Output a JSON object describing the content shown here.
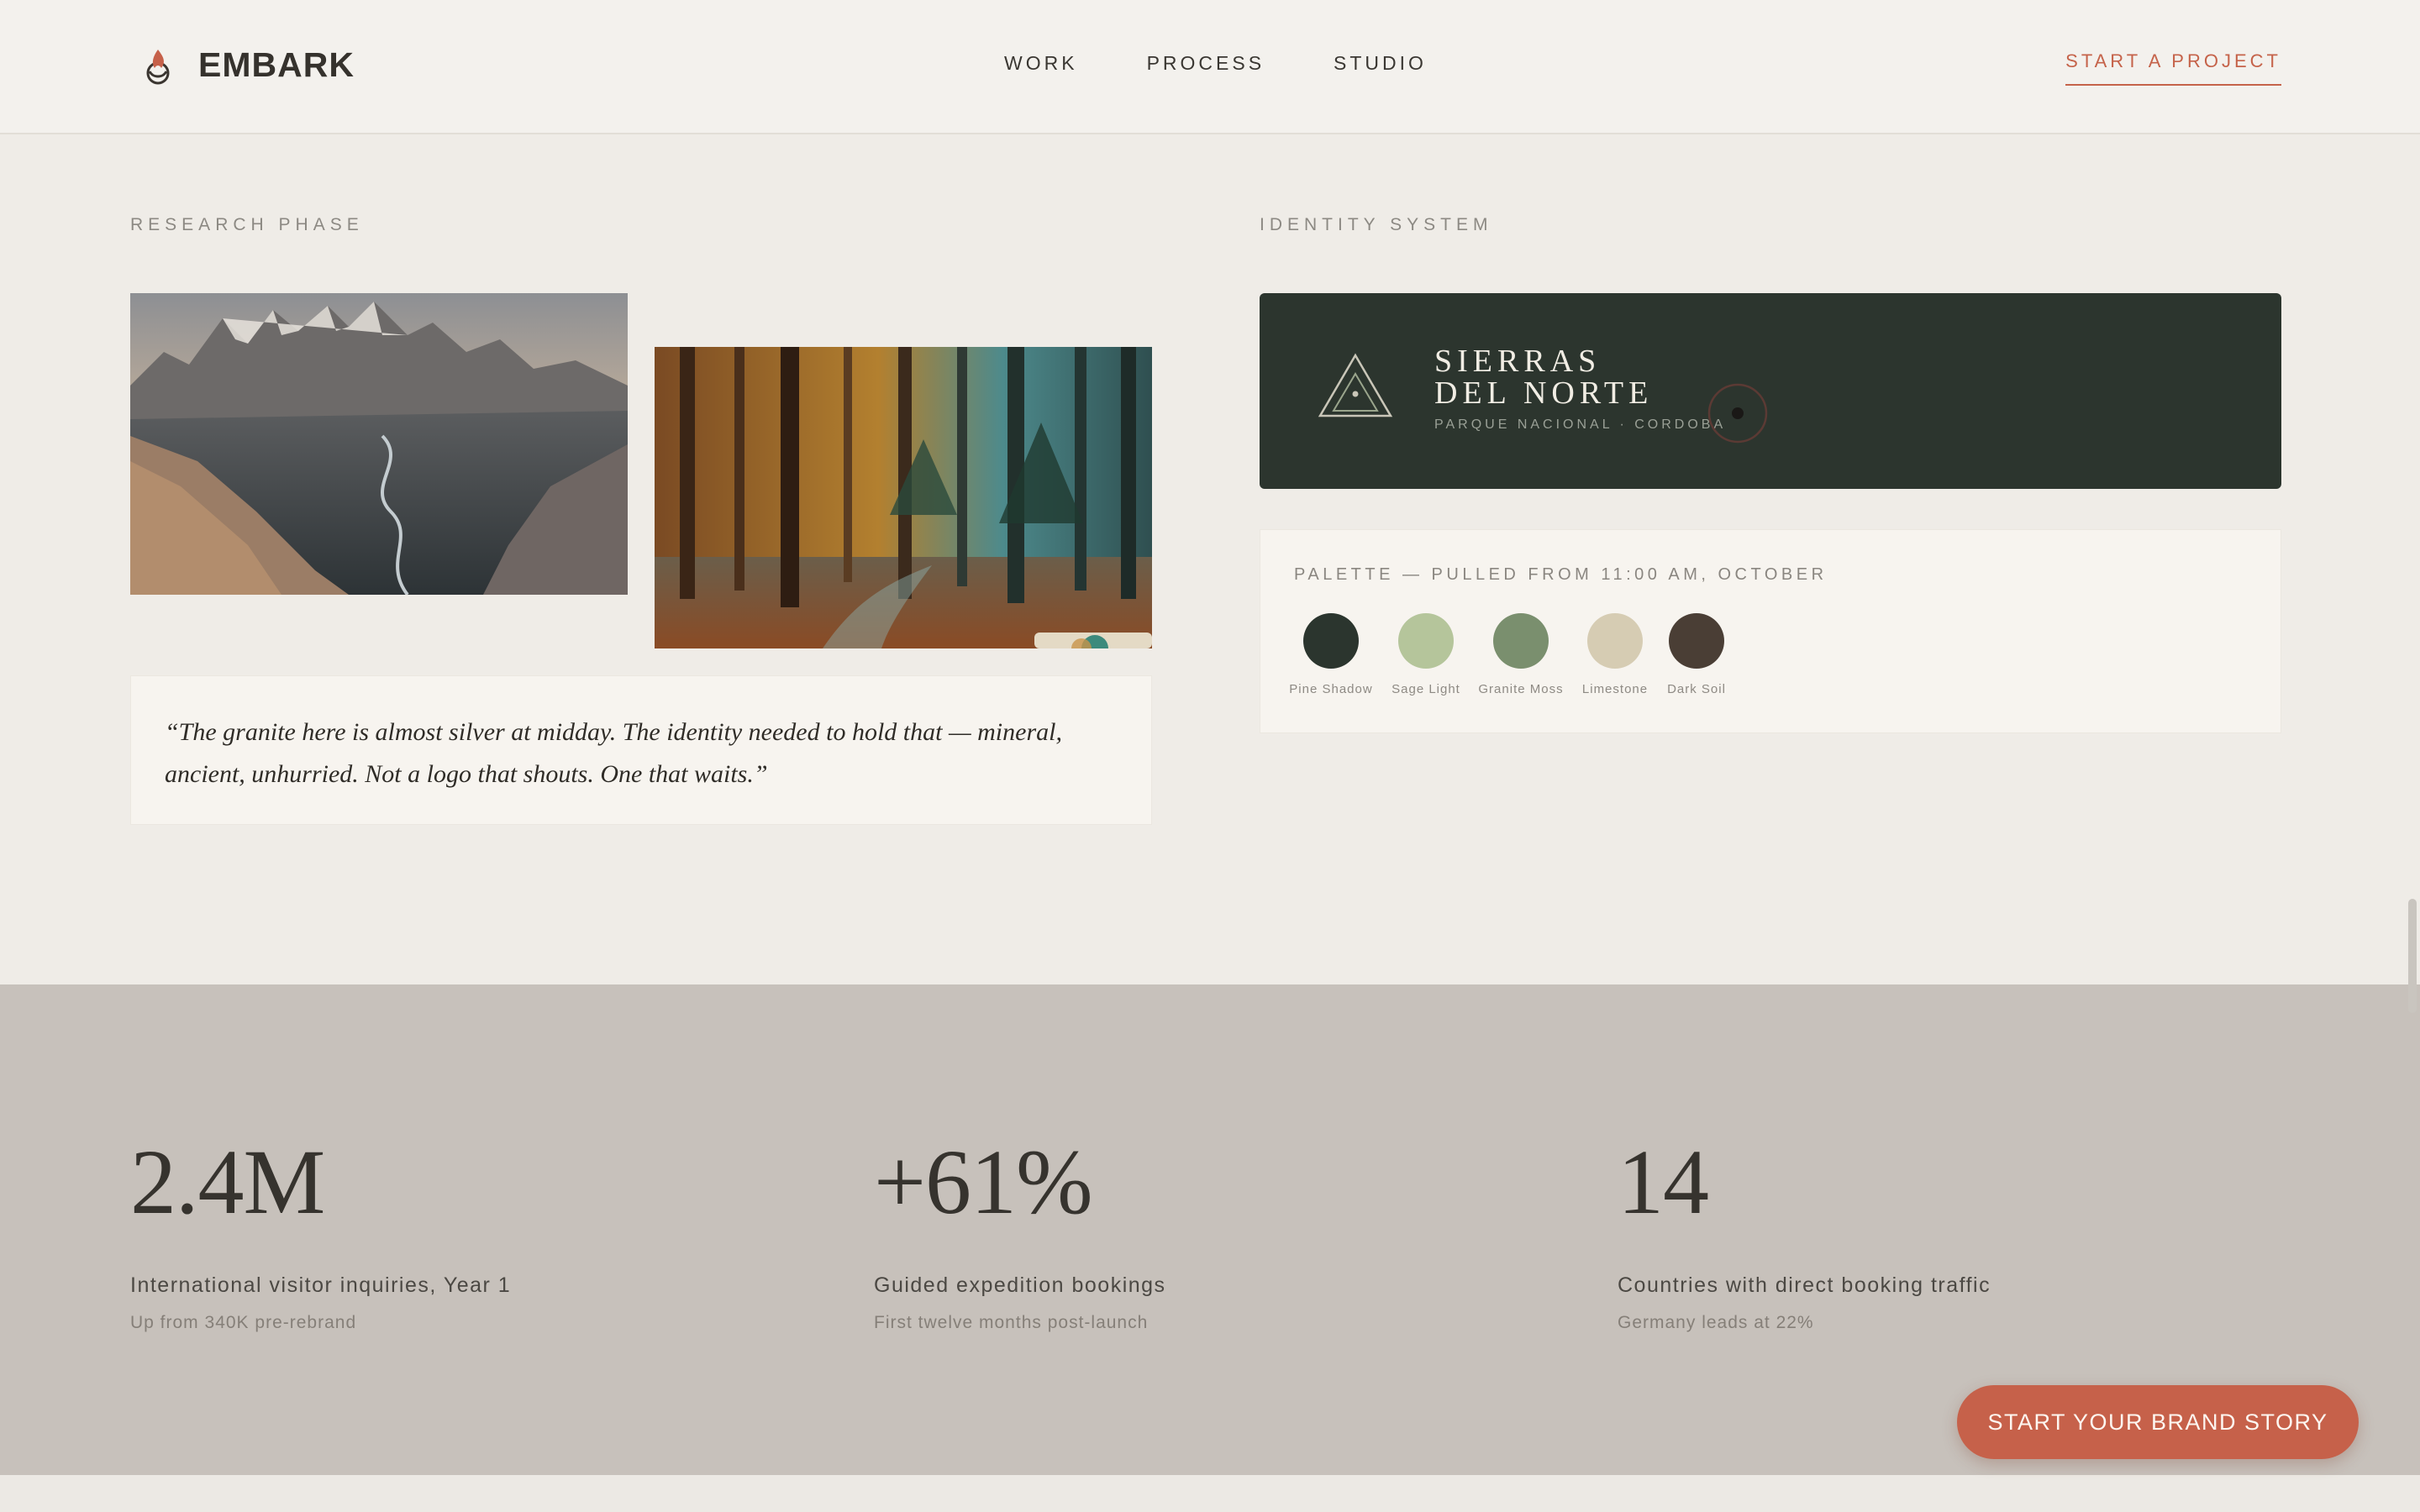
{
  "header": {
    "brand": "EMBARK",
    "nav": [
      "WORK",
      "PROCESS",
      "STUDIO"
    ],
    "cta": "START A PROJECT"
  },
  "research": {
    "label": "RESEARCH PHASE",
    "quote": "“The granite here is almost silver at midday. The identity needed to hold that — mineral, ancient, unhurried. Not a logo that shouts. One that waits.”"
  },
  "identity": {
    "label": "IDENTITY SYSTEM",
    "title_line1": "SIERRAS",
    "title_line2": "DEL NORTE",
    "subtitle": "PARQUE NACIONAL · CORDOBA"
  },
  "palette": {
    "label": "PALETTE — PULLED FROM 11:00 AM, OCTOBER",
    "swatches": [
      {
        "name": "Pine Shadow",
        "color": "#2b352e"
      },
      {
        "name": "Sage Light",
        "color": "#b5c59b"
      },
      {
        "name": "Granite Moss",
        "color": "#7a8f6e"
      },
      {
        "name": "Limestone",
        "color": "#d6ccb3"
      },
      {
        "name": "Dark Soil",
        "color": "#4a3e35"
      }
    ]
  },
  "stats": [
    {
      "value": "2.4M",
      "label": "International visitor inquiries, Year 1",
      "sub": "Up from 340K pre-rebrand"
    },
    {
      "value": "+61%",
      "label": "Guided expedition bookings",
      "sub": "First twelve months post-launch"
    },
    {
      "value": "14",
      "label": "Countries with direct booking traffic",
      "sub": "Germany leads at 22%"
    }
  ],
  "floating_cta": "START YOUR BRAND STORY",
  "colors": {
    "accent": "#c6614a",
    "dark_green": "#2c352e",
    "background": "#efece7",
    "stats_band": "#c7c1bb"
  }
}
